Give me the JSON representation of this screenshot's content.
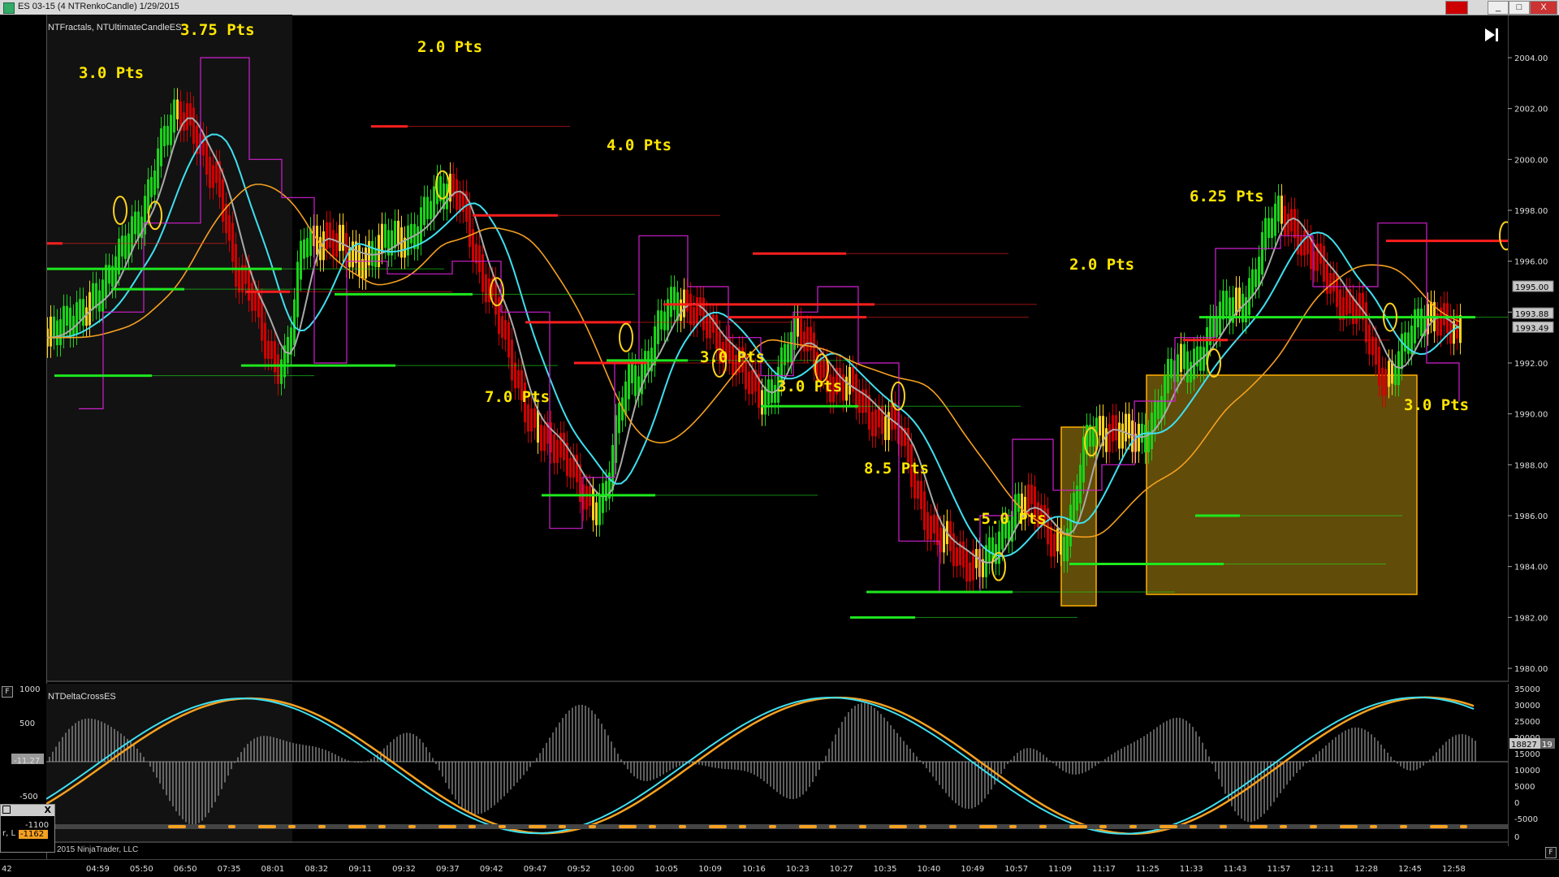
{
  "window": {
    "title": "ES 03-15 (4 NTRenkoCandle)  1/29/2015",
    "min_label": "_",
    "max_label": "□",
    "close_label": "X"
  },
  "main_panel": {
    "indicator_label": "NTFractals, NTUltimateCandleES",
    "play_end_icon": "skip-to-end-icon",
    "price_axis": [
      "2004.00",
      "2002.00",
      "2000.00",
      "1998.00",
      "1996.00",
      "1994.00",
      "1992.00",
      "1990.00",
      "1988.00",
      "1986.00",
      "1984.00",
      "1982.00",
      "1980.00"
    ],
    "price_tags": [
      "1995.00",
      "1993.88",
      "1993.49"
    ],
    "annotations": [
      "3.75 Pts",
      "3.0 Pts",
      "2.0 Pts",
      "4.0 Pts",
      "7.0 Pts",
      "3.0 Pts",
      "3.0 Pts",
      "8.5 Pts",
      "-5.0 Pts",
      "2.0 Pts",
      "6.25 Pts",
      "3.0 Pts"
    ]
  },
  "indicator_panel": {
    "label": "NTDeltaCrossES",
    "left_axis": [
      "1000",
      "500",
      "-11.27",
      "-500",
      "-1100",
      "-1162"
    ],
    "right_axis": [
      "35000",
      "30000",
      "25000",
      "20000",
      "15000",
      "10000",
      "5000",
      "0",
      "-5000",
      "0"
    ],
    "value_tag": "18827",
    "value_tag_suffix": "19",
    "copyright": "2015 NinjaTrader, LLC"
  },
  "time_axis": [
    "42",
    "04:59",
    "05:50",
    "06:50",
    "07:35",
    "08:01",
    "08:32",
    "09:11",
    "09:32",
    "09:37",
    "09:42",
    "09:47",
    "09:52",
    "10:00",
    "10:05",
    "10:09",
    "10:16",
    "10:23",
    "10:27",
    "10:35",
    "10:40",
    "10:49",
    "10:57",
    "11:09",
    "11:17",
    "11:25",
    "11:33",
    "11:43",
    "11:57",
    "12:11",
    "12:28",
    "12:45",
    "12:58"
  ],
  "mini_window": {
    "close_label": "X",
    "line1": "-1100",
    "line2": "-1162",
    "edge_text": "r, L"
  },
  "colors": {
    "bull": "#19d219",
    "bear": "#d00000",
    "neutral": "#ffd21e",
    "cyan_ma": "#3fe0f0",
    "orange_ma": "#f5a020",
    "gray_ma": "#aaaaaa",
    "magenta": "#d020d0",
    "highlight_box": "#b08a10",
    "pts_text": "#ffe600"
  }
}
